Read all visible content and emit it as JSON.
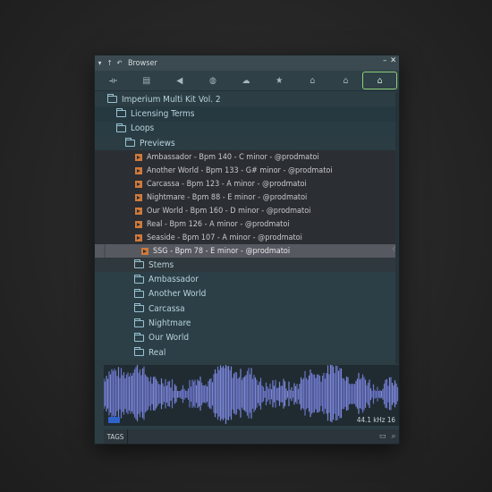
{
  "window": {
    "title": "Browser"
  },
  "toolbar": {
    "icons": [
      "plugin-icon",
      "file-icon",
      "speaker-icon",
      "globe-icon",
      "cloud-icon",
      "star-icon",
      "folder-icon",
      "folder-icon",
      "folder-active-icon"
    ]
  },
  "tree": {
    "root": "Imperium Multi Kit Vol. 2",
    "licensing": "Licensing Terms",
    "loops": "Loops",
    "previews": "Previews",
    "preview_items": [
      "Ambassador - Bpm 140 - C minor - @prodmatoi",
      "Another World - Bpm 133 - G# minor - @prodmatoi",
      "Carcassa - Bpm 123 - A minor - @prodmatoi",
      "Nightmare - Bpm 88 - E minor - @prodmatoi",
      "Our World - Bpm 160 - D minor - @prodmatoi",
      "Real - Bpm 126 - A minor - @prodmatoi",
      "Seaside - Bpm 107 - A minor - @prodmatoi"
    ],
    "selected_item": "SSG - Bpm 78 - E minor - @prodmatoi",
    "stems": "Stems",
    "stem_folders": [
      "Ambassador",
      "Another World",
      "Carcassa",
      "Nightmare",
      "Our World",
      "Real"
    ]
  },
  "waveform": {
    "rate": "44.1 kHz 16"
  },
  "tags": {
    "label": "TAGS"
  }
}
